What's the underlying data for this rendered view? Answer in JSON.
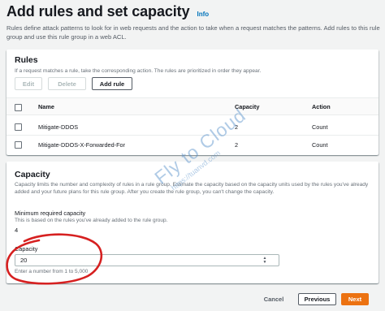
{
  "header": {
    "title": "Add rules and set capacity",
    "info_label": "Info",
    "description": "Rules define attack patterns to look for in web requests and the action to take when a request matches the patterns. Add rules to this rule group and use this rule group in a web ACL."
  },
  "rules_panel": {
    "title": "Rules",
    "description": "If a request matches a rule, take the corresponding action. The rules are prioritized in order they appear.",
    "buttons": {
      "edit": "Edit",
      "delete": "Delete",
      "add_rule": "Add rule"
    },
    "columns": {
      "name": "Name",
      "capacity": "Capacity",
      "action": "Action"
    },
    "rows": [
      {
        "name": "Mitigate-DDOS",
        "capacity": "2",
        "action": "Count"
      },
      {
        "name": "Mitigate-DDOS-X-Forwarded-For",
        "capacity": "2",
        "action": "Count"
      }
    ]
  },
  "capacity_panel": {
    "title": "Capacity",
    "description": "Capacity limits the number and complexity of rules in a rule group. Estimate the capacity based on the capacity units used by the rules you've already added and your future plans for this rule group. After you create the rule group, you can't change the capacity.",
    "minimum_label": "Minimum required capacity",
    "minimum_desc": "This is based on the rules you've already added to the rule group.",
    "minimum_value": "4",
    "capacity_label": "Capacity",
    "capacity_value": "20",
    "constraint": "Enter a number from 1 to 5,000"
  },
  "footer": {
    "cancel": "Cancel",
    "previous": "Previous",
    "next": "Next"
  },
  "watermark": {
    "main": "Fly to Cloud",
    "sub": "https://tuanvd.com"
  },
  "colors": {
    "primary_button": "#ec7211",
    "link": "#0073bb",
    "annotation_circle": "#d62020"
  }
}
